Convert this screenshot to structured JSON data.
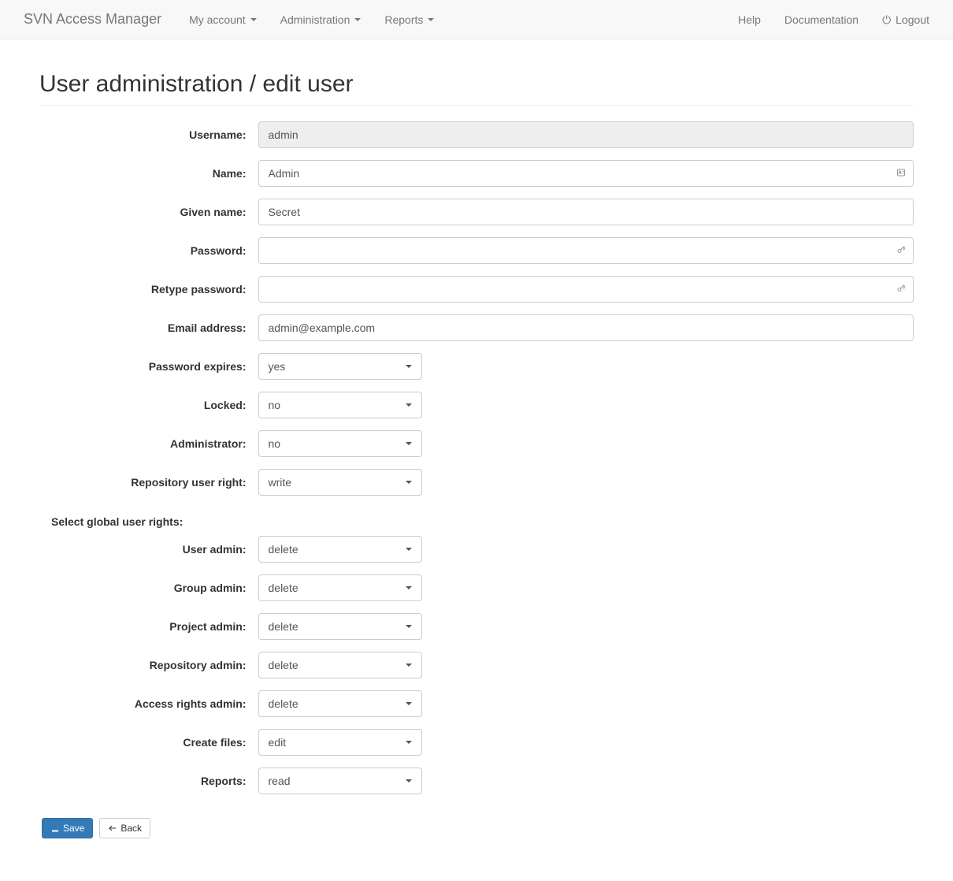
{
  "navbar": {
    "brand": "SVN Access Manager",
    "my_account": "My account",
    "administration": "Administration",
    "reports": "Reports",
    "help": "Help",
    "documentation": "Documentation",
    "logout": "Logout"
  },
  "page": {
    "title": "User administration / edit user"
  },
  "labels": {
    "username": "Username:",
    "name": "Name:",
    "given_name": "Given name:",
    "password": "Password:",
    "retype_password": "Retype password:",
    "email": "Email address:",
    "password_expires": "Password expires:",
    "locked": "Locked:",
    "administrator": "Administrator:",
    "repo_user_right": "Repository user right:",
    "section_global": "Select global user rights:",
    "user_admin": "User admin:",
    "group_admin": "Group admin:",
    "project_admin": "Project admin:",
    "repository_admin": "Repository admin:",
    "access_rights_admin": "Access rights admin:",
    "create_files": "Create files:",
    "reports": "Reports:"
  },
  "values": {
    "username": "admin",
    "name": "Admin",
    "given_name": "Secret",
    "password": "",
    "retype_password": "",
    "email": "admin@example.com",
    "password_expires": "yes",
    "locked": "no",
    "administrator": "no",
    "repo_user_right": "write",
    "user_admin": "delete",
    "group_admin": "delete",
    "project_admin": "delete",
    "repository_admin": "delete",
    "access_rights_admin": "delete",
    "create_files": "edit",
    "reports": "read"
  },
  "buttons": {
    "save": "Save",
    "back": "Back"
  }
}
